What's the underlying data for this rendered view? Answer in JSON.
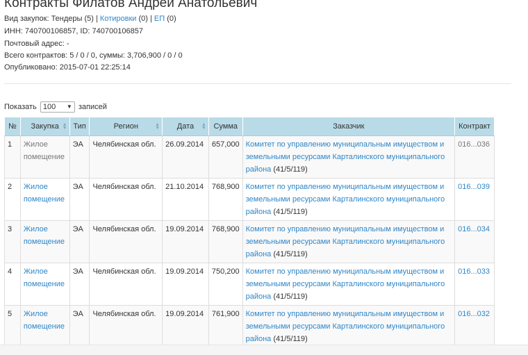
{
  "header": {
    "title": "Контракты Филатов Андрей Анатольевич",
    "purchase_type_label": "Вид закупок:",
    "tenders": "Тендеры (5)",
    "separator": "|",
    "quotes_link": "Котировки",
    "quotes_count": "(0)",
    "ep_link": "ЕП",
    "ep_count": "(0)",
    "inn_line": "ИНН: 740700106857, ID: 740700106857",
    "postal_line": "Почтовый адрес: -",
    "totals_line": "Всего контрактов: 5 / 0 / 0, суммы: 3,706,900 / 0 / 0",
    "published_line": "Опубликовано: 2015-07-01 22:25:14"
  },
  "length_control": {
    "show_label": "Показать",
    "selected": "100",
    "records_label": "записей"
  },
  "table": {
    "headers": [
      "№",
      "Закупка",
      "Тип",
      "Регион",
      "Дата",
      "Сумма",
      "Заказчик",
      "Контракт"
    ],
    "rows": [
      {
        "num": "1",
        "purchase": "Жилое помещение",
        "type": "ЭА",
        "region": "Челябинская обл.",
        "date": "26.09.2014",
        "sum": "657,000",
        "customer": "Комитет по управлению муниципальным имуществом и земельными ресурсами Карталинского муниципального района",
        "customer_code": "(41/5/119)",
        "contract": "016...036"
      },
      {
        "num": "2",
        "purchase": "Жилое помещение",
        "type": "ЭА",
        "region": "Челябинская обл.",
        "date": "21.10.2014",
        "sum": "768,900",
        "customer": "Комитет по управлению муниципальным имуществом и земельными ресурсами Карталинского муниципального района",
        "customer_code": "(41/5/119)",
        "contract": "016...039"
      },
      {
        "num": "3",
        "purchase": "Жилое помещение",
        "type": "ЭА",
        "region": "Челябинская обл.",
        "date": "19.09.2014",
        "sum": "768,900",
        "customer": "Комитет по управлению муниципальным имуществом и земельными ресурсами Карталинского муниципального района",
        "customer_code": "(41/5/119)",
        "contract": "016...034"
      },
      {
        "num": "4",
        "purchase": "Жилое помещение",
        "type": "ЭА",
        "region": "Челябинская обл.",
        "date": "19.09.2014",
        "sum": "750,200",
        "customer": "Комитет по управлению муниципальным имуществом и земельными ресурсами Карталинского муниципального района",
        "customer_code": "(41/5/119)",
        "contract": "016...033"
      },
      {
        "num": "5",
        "purchase": "Жилое помещение",
        "type": "ЭА",
        "region": "Челябинская обл.",
        "date": "19.09.2014",
        "sum": "761,900",
        "customer": "Комитет по управлению муниципальным имуществом и земельными ресурсами Карталинского муниципального района",
        "customer_code": "(41/5/119)",
        "contract": "016...032"
      }
    ]
  },
  "colors": {
    "link": "#2f86c7",
    "header_bg": "#b9dbe8",
    "text": "#333333"
  },
  "icons": {
    "sort": "sort-arrows-icon",
    "select_caret": "chevron-down-icon"
  }
}
